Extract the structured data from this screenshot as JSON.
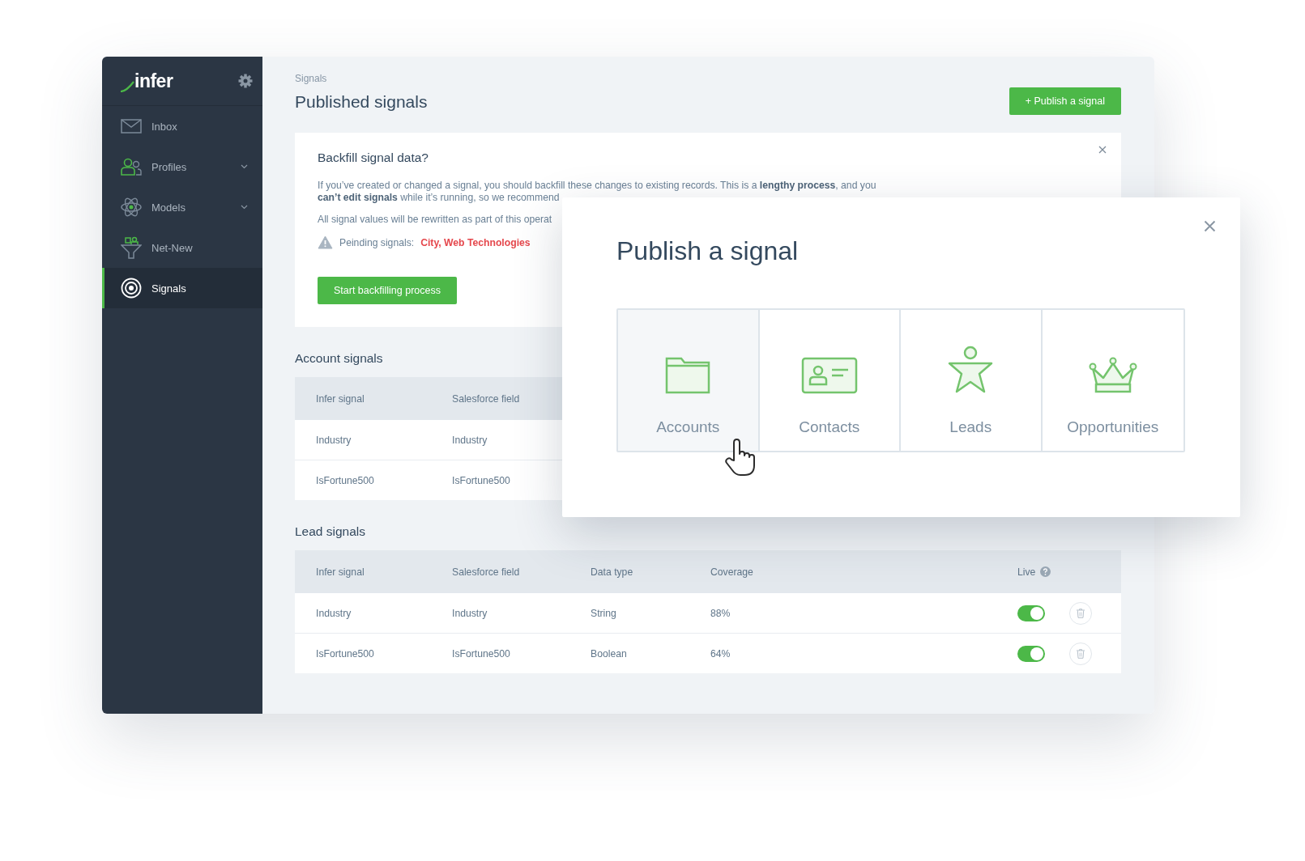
{
  "sidebar": {
    "logo": "infer",
    "items": [
      {
        "label": "Inbox",
        "expandable": false,
        "selected": false
      },
      {
        "label": "Profiles",
        "expandable": true,
        "selected": false
      },
      {
        "label": "Models",
        "expandable": true,
        "selected": false
      },
      {
        "label": "Net-New",
        "expandable": false,
        "selected": false
      },
      {
        "label": "Signals",
        "expandable": false,
        "selected": true
      }
    ]
  },
  "header": {
    "breadcrumb": "Signals",
    "title": "Published signals",
    "action": "+ Publish a signal"
  },
  "backfill": {
    "title": "Backfill signal data?",
    "paragraphs": [
      "If you’ve created or changed a signal, you should backfill these changes to existing records. This is a **lengthy process**, and you **can’t edit signals** while it’s running, so we recommend",
      "All signal values will be rewritten as part of this operat"
    ],
    "pending_label": "Peinding signals:",
    "pending_value": "City, Web Technologies",
    "button": "Start backfilling process"
  },
  "account_signals": {
    "title": "Account signals",
    "columns": [
      "Infer signal",
      "Salesforce field"
    ],
    "rows": [
      {
        "cells": [
          "Industry",
          "Industry"
        ]
      },
      {
        "cells": [
          "IsFortune500",
          "IsFortune500"
        ]
      }
    ]
  },
  "lead_signals": {
    "title": "Lead signals",
    "columns": [
      "Infer signal",
      "Salesforce field",
      "Data type",
      "Coverage"
    ],
    "live_column": "Live",
    "rows": [
      {
        "cells": [
          "Industry",
          "Industry",
          "String",
          "88%"
        ],
        "live": true
      },
      {
        "cells": [
          "IsFortune500",
          "IsFortune500",
          "Boolean",
          "64%"
        ],
        "live": true
      }
    ]
  },
  "modal": {
    "title": "Publish a signal",
    "options": [
      {
        "label": "Accounts",
        "hovered": true
      },
      {
        "label": "Contacts",
        "hovered": false
      },
      {
        "label": "Leads",
        "hovered": false
      },
      {
        "label": "Opportunities",
        "hovered": false
      }
    ]
  }
}
